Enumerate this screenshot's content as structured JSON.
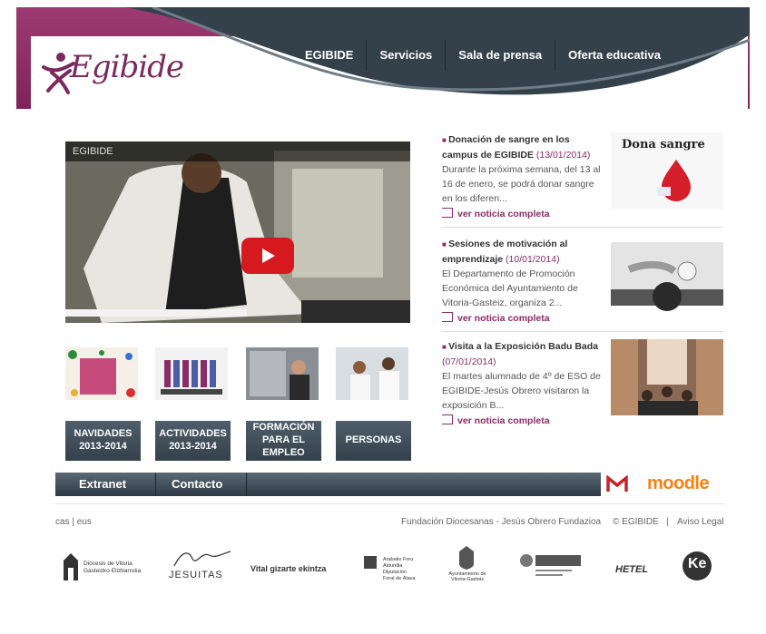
{
  "header": {
    "logo_text": "Egibide",
    "nav": [
      "EGIBIDE",
      "Servicios",
      "Sala de prensa",
      "Oferta educativa"
    ]
  },
  "video": {
    "channel_label": "EGIBIDE"
  },
  "tiles": [
    "NAVIDADES 2013-2014",
    "ACTIVIDADES 2013-2014",
    "FORMACIÓN PARA EL EMPLEO",
    "PERSONAS"
  ],
  "news": [
    {
      "title": "Donación de sangre en los campus de EGIBIDE",
      "date": "(13/01/2014)",
      "body": "Durante la próxima semana, del 13 al 16 de enero, se podrá donar sangre en los diferen...",
      "more": "ver noticia completa",
      "image_text": "Dona sangre"
    },
    {
      "title": "Sesiones de motivación al emprendizaje",
      "date": "(10/01/2014)",
      "body": "El Departamento de Promoción Económica del Ayuntamiento de Vitoria-Gasteiz, organiza 2...",
      "more": "ver noticia completa"
    },
    {
      "title": "Visita a la Exposición Badu Bada",
      "date": "(07/01/2014)",
      "body": "El martes alumnado de 4º de ESO de EGIBIDE-Jesús Obrero visitaron la exposición B...",
      "more": "ver noticia completa"
    }
  ],
  "bottombar": {
    "extranet": "Extranet",
    "contacto": "Contacto",
    "moodle": "moodle"
  },
  "footer": {
    "lang": "cas | eus",
    "fundacion": "Fundación Diocesanas - Jesús Obrero Fundazioa",
    "copyright": "© EGIBIDE",
    "divider": "|",
    "aviso": "Aviso Legal"
  },
  "partners": {
    "diocesis": "Diócesis de Vitoria Gasteizko Elizbarrutia",
    "jesuitas": "JESUITAS",
    "vital": "Vital gizarte ekintza",
    "araba": "Arabako Foru Aldundia Diputación Foral de Álava",
    "ayuntamiento": "Ayuntamiento de Vitoria-Gasteiz",
    "hetel": "HETEL",
    "ke": "Ke"
  },
  "colors": {
    "brand": "#8b2c68",
    "nav": "#2f3c46",
    "youtube": "#d6191f",
    "moodle": "#f98012"
  }
}
